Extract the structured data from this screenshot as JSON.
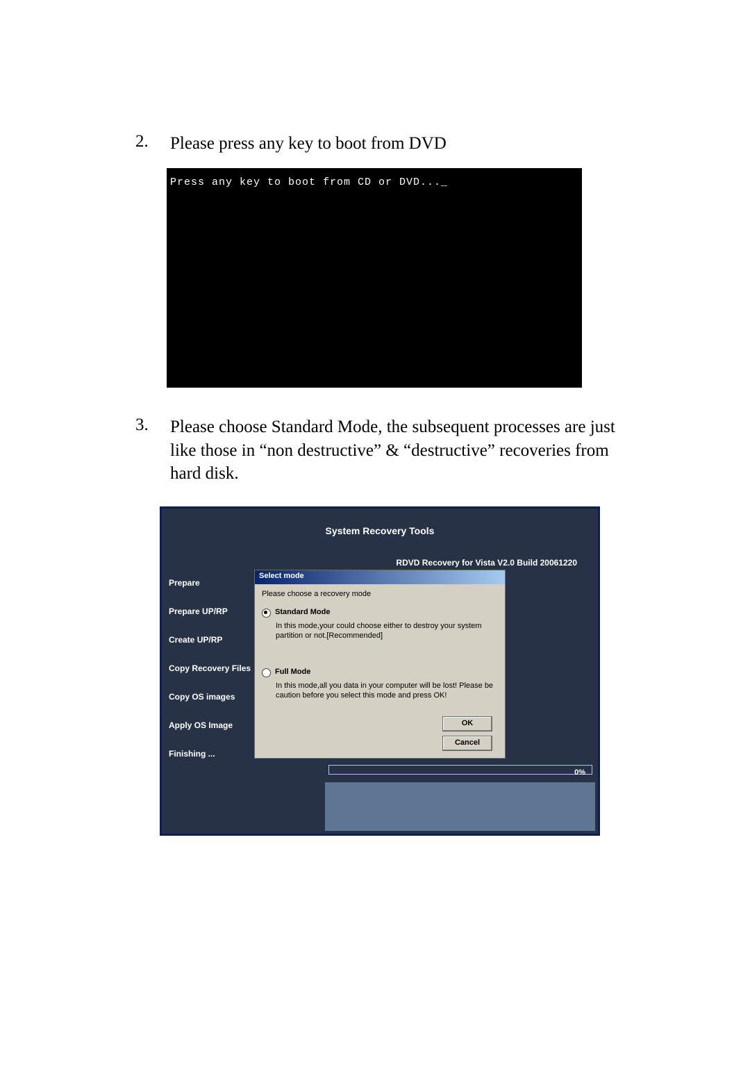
{
  "step2": {
    "num": "2.",
    "text": "Please press any key to boot from DVD"
  },
  "bios": {
    "line": "Press any key to boot from CD or DVD..._"
  },
  "step3": {
    "num": "3.",
    "text": "Please choose Standard Mode, the subsequent processes are just like those in “non destructive” & “destructive” recoveries from hard disk."
  },
  "tool": {
    "title": "System Recovery Tools",
    "version": "RDVD Recovery for Vista V2.0 Build 20061220",
    "sidebar": [
      "Prepare",
      "Prepare UP/RP",
      "Create UP/RP",
      "Copy Recovery Files",
      "Copy OS images",
      "Apply OS Image",
      "Finishing ..."
    ],
    "dialog": {
      "title": "Select mode",
      "prompt": "Please choose a recovery mode",
      "opt1": {
        "label": "Standard Mode",
        "desc": "In this mode,your could choose either to destroy your system partition or not.[Recommended]"
      },
      "opt2": {
        "label": "Full Mode",
        "desc": "In this mode,all you data in your computer will be lost! Please be caution before you select this mode and press OK!"
      },
      "ok": "OK",
      "cancel": "Cancel"
    },
    "progress_pct": "0%"
  }
}
